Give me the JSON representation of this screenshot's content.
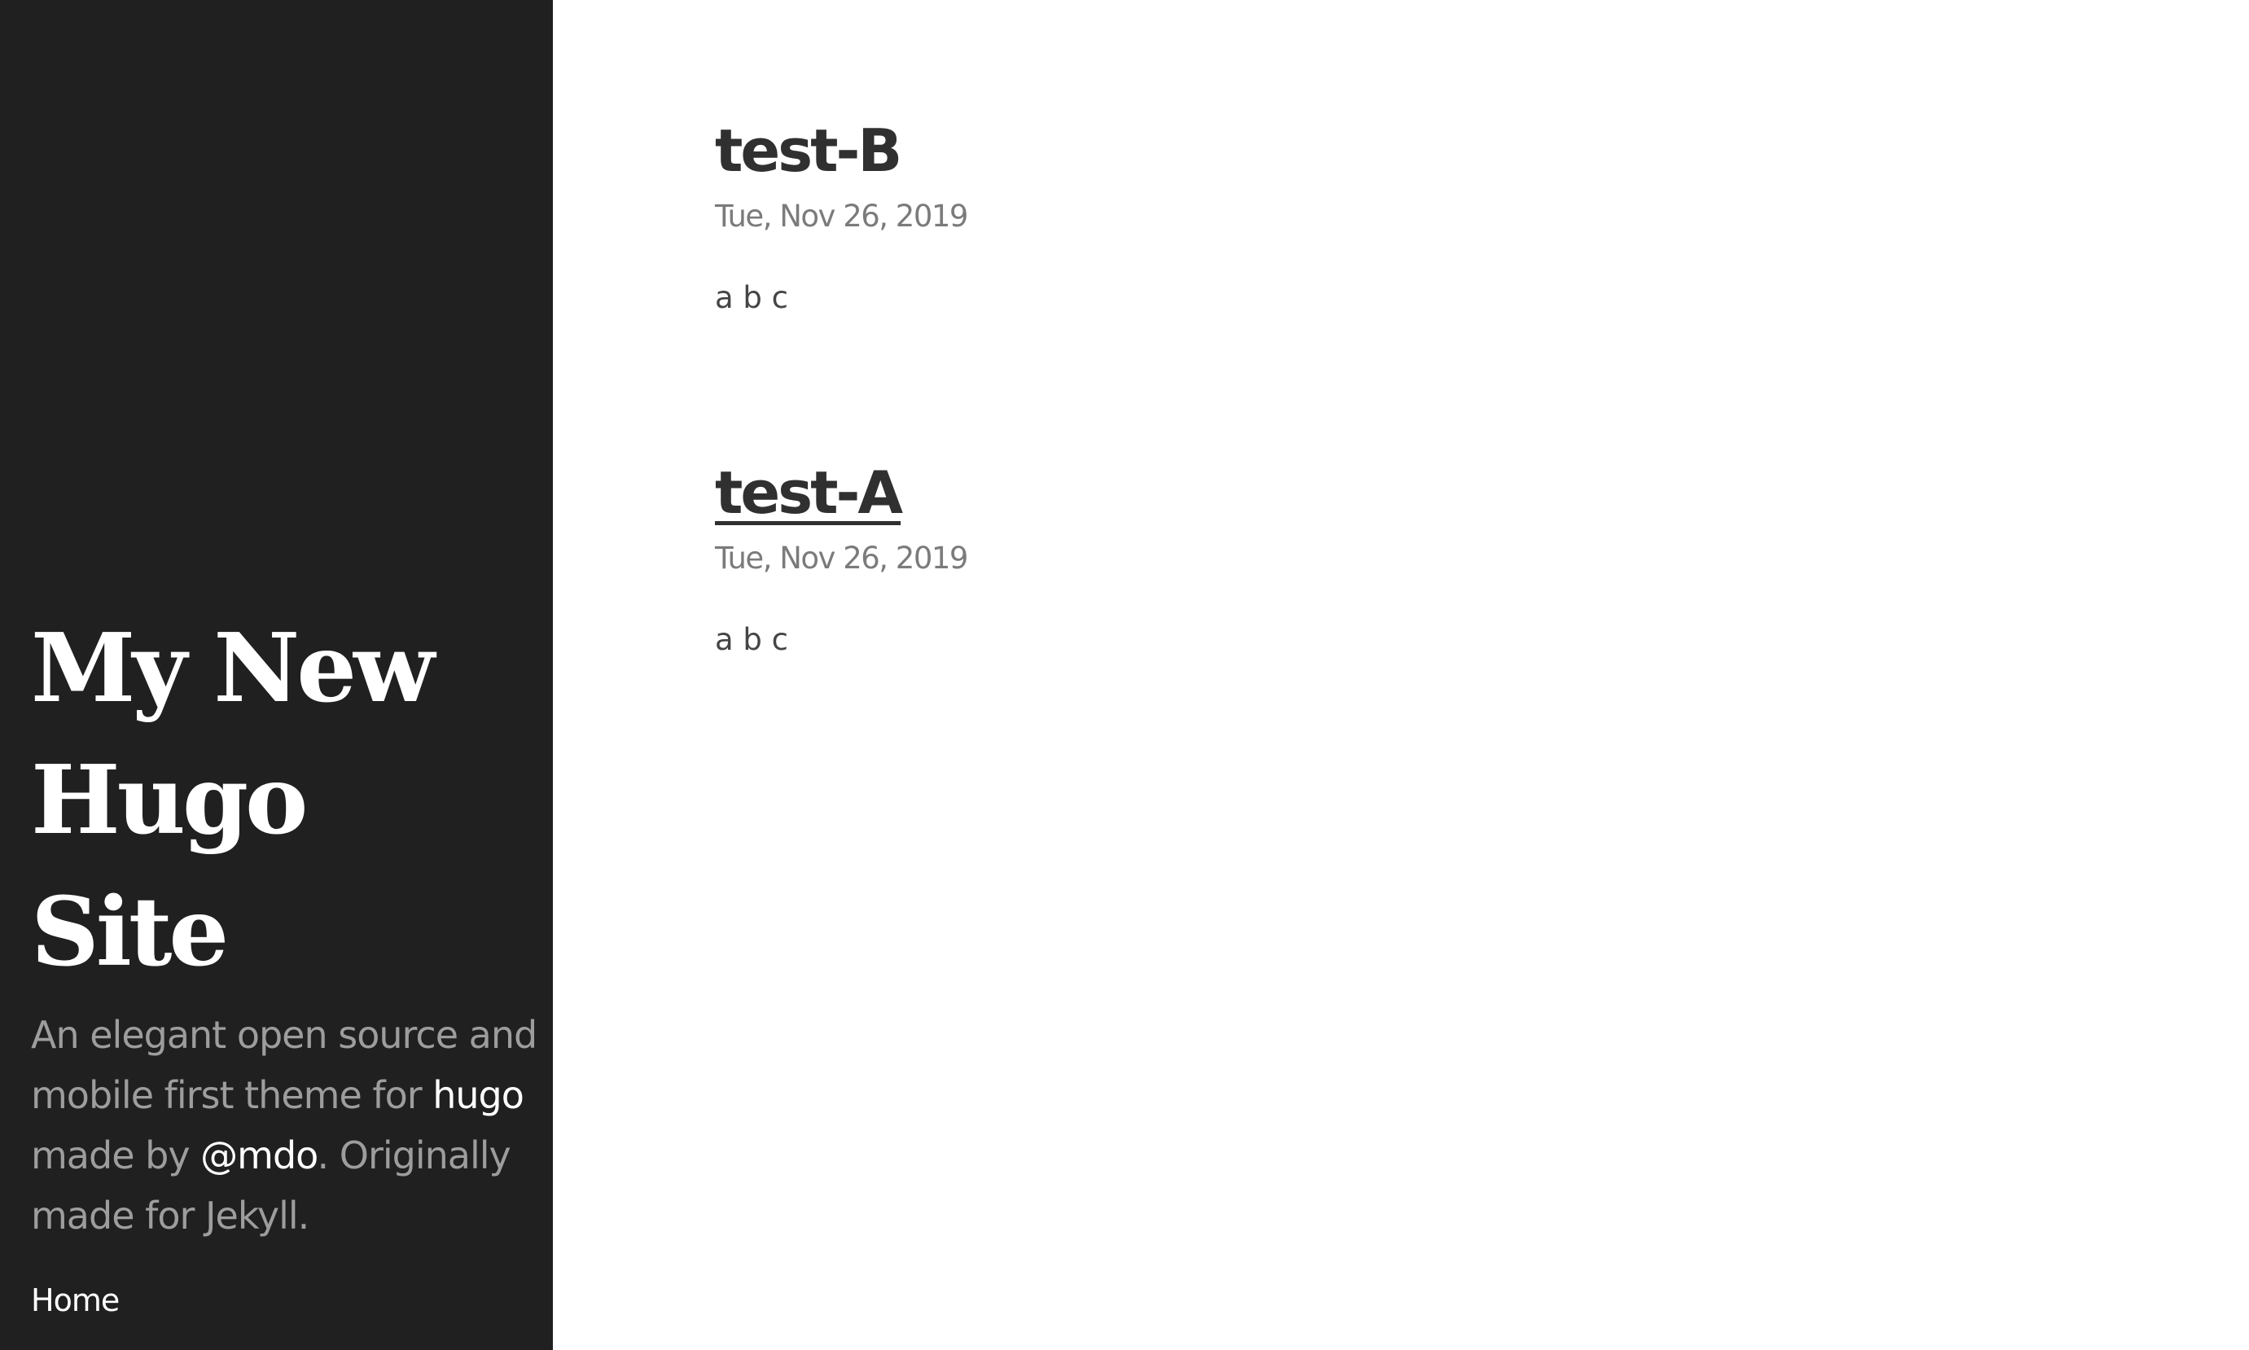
{
  "sidebar": {
    "site_title_lines": [
      "My New",
      "Hugo",
      "Site"
    ],
    "description": {
      "part1": "An elegant open source and mobile first theme for ",
      "link_hugo": "hugo",
      "part2": " made by ",
      "link_mdo": "@mdo",
      "part3": ". Originally made for Jekyll."
    },
    "nav": {
      "home_label": "Home"
    }
  },
  "posts": [
    {
      "title": "test-B",
      "date": "Tue, Nov 26, 2019",
      "body": "a b c"
    },
    {
      "title": "test-A",
      "date": "Tue, Nov 26, 2019",
      "body": "a b c"
    }
  ],
  "colors": {
    "sidebar_bg": "#202020",
    "page_bg": "#ffffff",
    "title_text": "#303030",
    "date_text": "#7b7b7b",
    "sidebar_muted_text": "#9d9d9d",
    "sidebar_link_text": "#ffffff"
  }
}
